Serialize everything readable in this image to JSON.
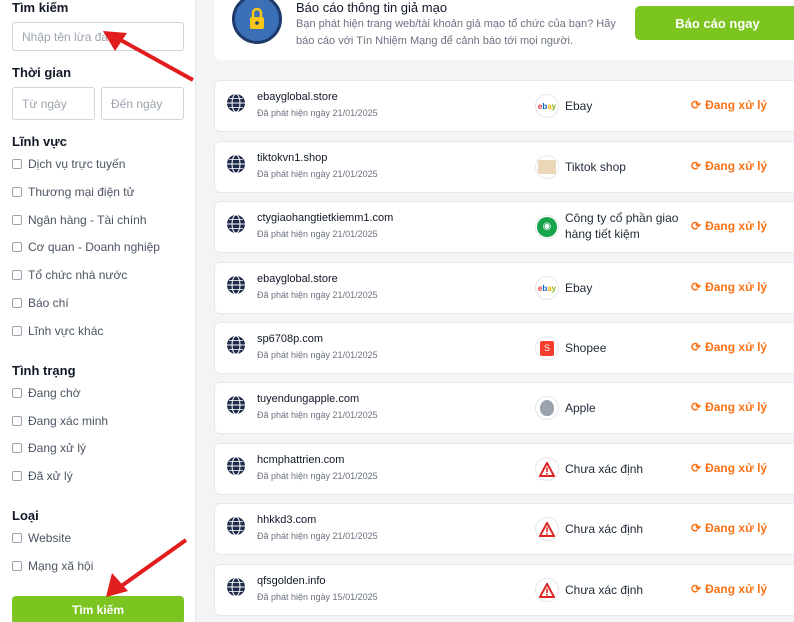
{
  "filters": {
    "search_title": "Tìm kiếm",
    "search_placeholder": "Nhập tên lừa đảo",
    "time_title": "Thời gian",
    "from_placeholder": "Từ ngày",
    "to_placeholder": "Đến ngày",
    "field_title": "Lĩnh vực",
    "fields": [
      "Dịch vụ trực tuyến",
      "Thương mại điện tử",
      "Ngân hàng - Tài chính",
      "Cơ quan - Doanh nghiệp",
      "Tổ chức nhà nước",
      "Báo chí",
      "Lĩnh vực khác"
    ],
    "status_title": "Tình trạng",
    "statuses": [
      "Đang chờ",
      "Đang xác minh",
      "Đang xử lý",
      "Đã xử lý"
    ],
    "type_title": "Loại",
    "types": [
      "Website",
      "Mạng xã hội"
    ],
    "search_button": "Tìm kiếm"
  },
  "banner": {
    "title": "Báo cáo thông tin giả mạo",
    "description": "Bạn phát hiện trang web/tài khoản giả mạo tổ chức của bạn? Hãy báo cáo với Tín Nhiệm Mạng để cảnh báo tới mọi người.",
    "button": "Báo cáo ngay"
  },
  "reports": [
    {
      "domain": "ebayglobal.store",
      "date": "Đã phát hiện ngày 21/01/2025",
      "brand": "Ebay",
      "logo": "ebay-logo",
      "status": "Đang xử lý"
    },
    {
      "domain": "tiktokvn1.shop",
      "date": "Đã phát hiện ngày 21/01/2025",
      "brand": "Tiktok shop",
      "logo": "tiktok-shop-logo",
      "status": "Đang xử lý"
    },
    {
      "domain": "ctygiaohangtietkiemm1.com",
      "date": "Đã phát hiện ngày 21/01/2025",
      "brand": "Công ty cổ phần giao hàng tiết kiệm",
      "logo": "ghtk-logo",
      "status": "Đang xử lý"
    },
    {
      "domain": "ebayglobal.store",
      "date": "Đã phát hiện ngày 21/01/2025",
      "brand": "Ebay",
      "logo": "ebay-logo",
      "status": "Đang xử lý"
    },
    {
      "domain": "sp6708p.com",
      "date": "Đã phát hiện ngày 21/01/2025",
      "brand": "Shopee",
      "logo": "shopee-logo",
      "status": "Đang xử lý"
    },
    {
      "domain": "tuyendungapple.com",
      "date": "Đã phát hiện ngày 21/01/2025",
      "brand": "Apple",
      "logo": "apple-logo",
      "status": "Đang xử lý"
    },
    {
      "domain": "hcmphattrien.com",
      "date": "Đã phát hiện ngày 21/01/2025",
      "brand": "Chưa xác định",
      "logo": "warning-icon",
      "status": "Đang xử lý"
    },
    {
      "domain": "hhkkd3.com",
      "date": "Đã phát hiện ngày 21/01/2025",
      "brand": "Chưa xác định",
      "logo": "warning-icon",
      "status": "Đang xử lý"
    },
    {
      "domain": "qfsgolden.info",
      "date": "Đã phát hiện ngày 15/01/2025",
      "brand": "Chưa xác định",
      "logo": "warning-icon",
      "status": "Đang xử lý"
    }
  ],
  "colors": {
    "accent": "#7cc41f",
    "status": "#f97316",
    "arrow": "#e11d1d"
  }
}
